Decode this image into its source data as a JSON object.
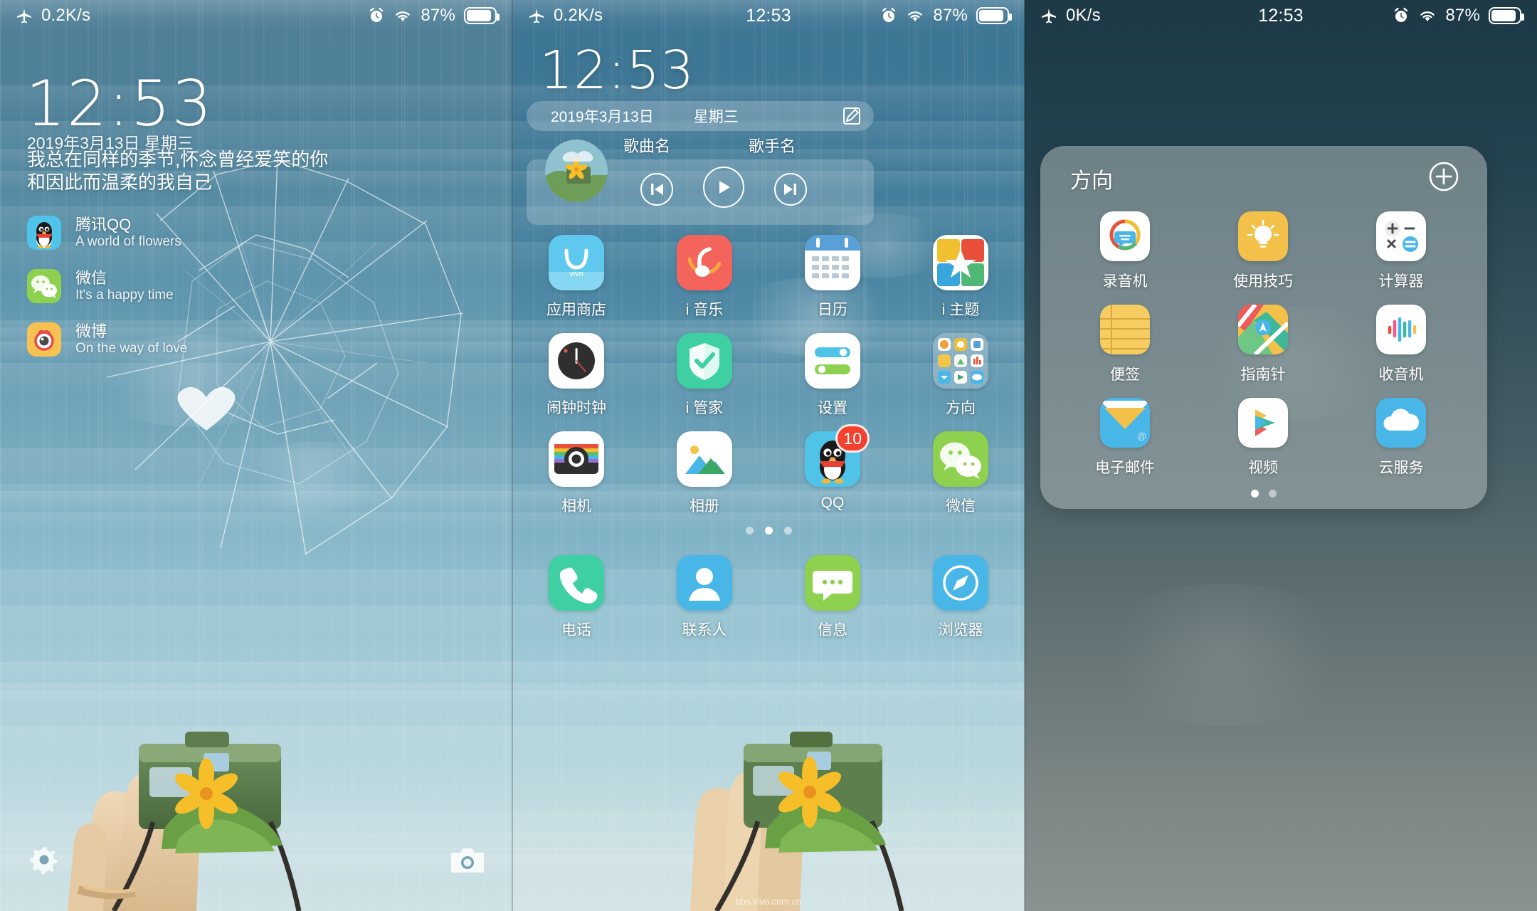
{
  "panels": [
    {
      "name": "lock-screen",
      "status": {
        "left_icon": "airplane-icon",
        "net_speed": "0.2K/s",
        "alarm_icon": "alarm-icon",
        "wifi_icon": "wifi-icon",
        "battery_text": "87%",
        "time": ""
      },
      "clock": "12:53",
      "date": "2019年3月13日 星期三",
      "quote_line1": "我总在同样的季节,怀念曾经爱笑的你",
      "quote_line2": "和因此而温柔的我自己",
      "notifications": [
        {
          "app": "腾讯QQ",
          "text": "A world of flowers",
          "icon": "qq-penguin-icon",
          "color": "#4fc3e8"
        },
        {
          "app": "微信",
          "text": "It's a happy time",
          "icon": "wechat-icon",
          "color": "#8ed14f"
        },
        {
          "app": "微博",
          "text": "On the way of love",
          "icon": "weibo-eye-icon",
          "color": "#f6c251"
        }
      ],
      "shortcuts": {
        "left": "settings-gear-icon",
        "right": "camera-icon"
      }
    },
    {
      "name": "home-screen",
      "status": {
        "left_icon": "airplane-icon",
        "net_speed": "0.2K/s",
        "time": "12:53",
        "alarm_icon": "alarm-icon",
        "wifi_icon": "wifi-icon",
        "battery_text": "87%"
      },
      "clock": "12:53",
      "date": "2019年3月13日",
      "weekday": "星期三",
      "edit_icon": "edit-pencil-icon",
      "music": {
        "song_label": "歌曲名",
        "artist_label": "歌手名",
        "prev_icon": "skip-previous-icon",
        "play_icon": "play-icon",
        "next_icon": "skip-next-icon",
        "album_art": "flower-camera-thumb"
      },
      "app_rows": [
        [
          {
            "label": "应用商店",
            "icon": "vivo-appstore-icon"
          },
          {
            "label": "i 音乐",
            "icon": "imusic-icon"
          },
          {
            "label": "日历",
            "icon": "calendar-icon"
          },
          {
            "label": "i 主题",
            "icon": "itheme-icon"
          }
        ],
        [
          {
            "label": "闹钟时钟",
            "icon": "clock-icon"
          },
          {
            "label": "i 管家",
            "icon": "imanager-shield-icon"
          },
          {
            "label": "设置",
            "icon": "settings-toggles-icon"
          },
          {
            "label": "方向",
            "icon": "folder-direction-icon"
          }
        ],
        [
          {
            "label": "相机",
            "icon": "camera-app-icon"
          },
          {
            "label": "相册",
            "icon": "gallery-icon"
          },
          {
            "label": "QQ",
            "icon": "qq-penguin-icon",
            "badge": "10"
          },
          {
            "label": "微信",
            "icon": "wechat-icon"
          }
        ]
      ],
      "dock": [
        {
          "label": "电话",
          "icon": "phone-icon"
        },
        {
          "label": "联系人",
          "icon": "contacts-icon"
        },
        {
          "label": "信息",
          "icon": "messages-icon"
        },
        {
          "label": "浏览器",
          "icon": "browser-compass-icon"
        }
      ],
      "page_dots": {
        "count": 3,
        "active": 1
      },
      "watermark": "bbs.vivo.com.cn"
    },
    {
      "name": "folder-open",
      "status": {
        "left_icon": "airplane-icon",
        "net_speed": "0K/s",
        "time": "12:53",
        "alarm_icon": "alarm-icon",
        "wifi_icon": "wifi-icon",
        "battery_text": "87%"
      },
      "folder_title": "方向",
      "add_icon": "plus-circle-icon",
      "folder_apps": [
        {
          "label": "录音机",
          "icon": "recorder-icon"
        },
        {
          "label": "使用技巧",
          "icon": "tips-bulb-icon"
        },
        {
          "label": "计算器",
          "icon": "calculator-icon"
        },
        {
          "label": "便签",
          "icon": "notes-icon"
        },
        {
          "label": "指南针",
          "icon": "compass-map-icon"
        },
        {
          "label": "收音机",
          "icon": "radio-icon"
        },
        {
          "label": "电子邮件",
          "icon": "email-icon"
        },
        {
          "label": "视频",
          "icon": "video-play-icon"
        },
        {
          "label": "云服务",
          "icon": "cloud-service-icon"
        }
      ],
      "page_dots": {
        "count": 2,
        "active": 0
      }
    }
  ],
  "colors": {
    "accent_blue": "#4fc3e8",
    "badge_red": "#f4402e",
    "wechat_green": "#8ed14f",
    "weibo_orange": "#f6c251"
  }
}
